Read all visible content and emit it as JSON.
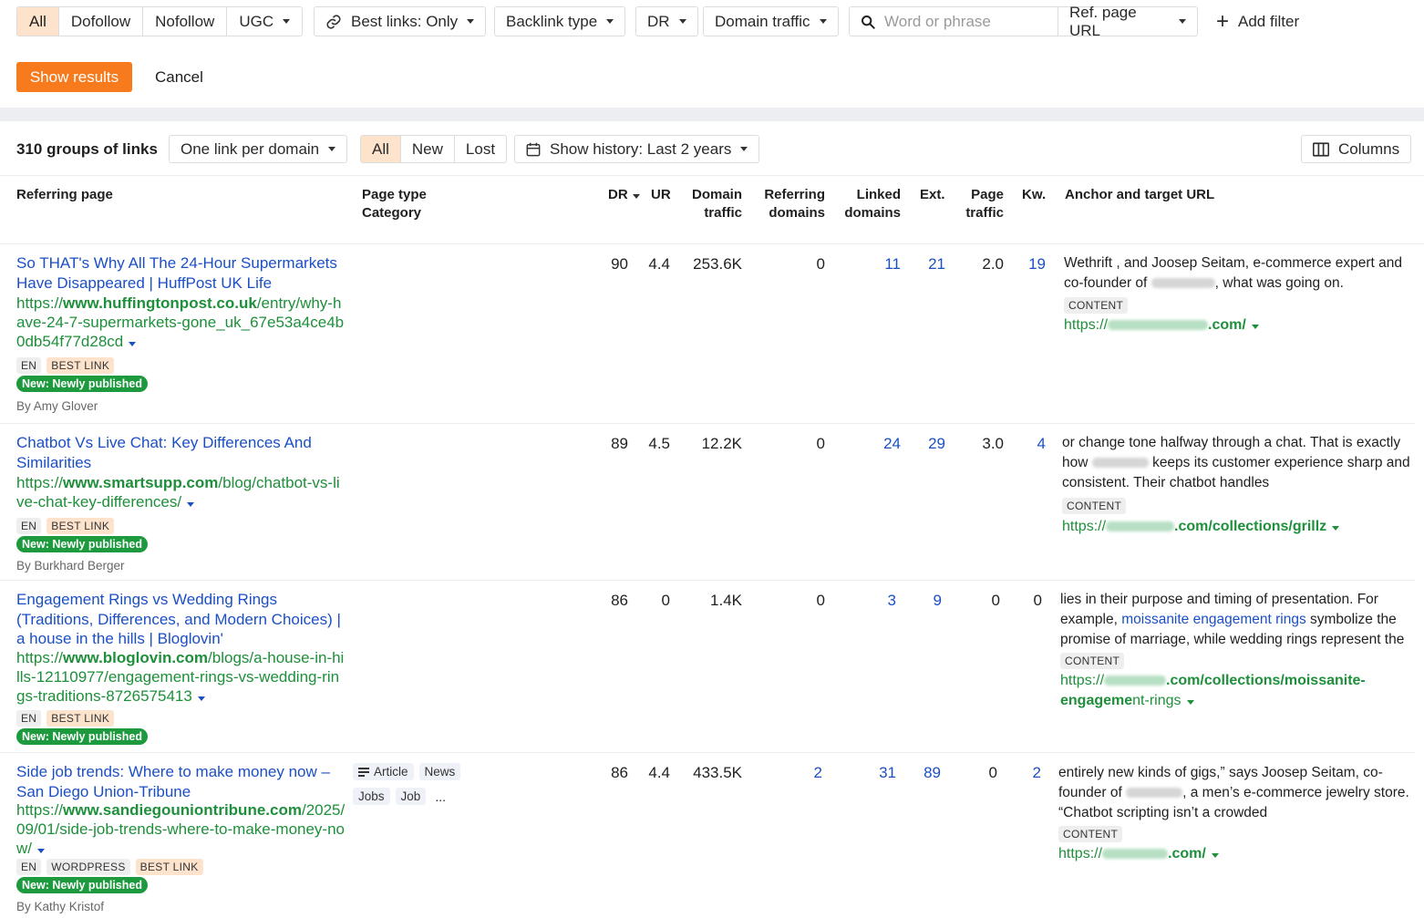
{
  "filters": {
    "link_types": [
      "All",
      "Dofollow",
      "Nofollow",
      "UGC"
    ],
    "best_links": "Best links: Only",
    "backlink_type": "Backlink type",
    "dr": "DR",
    "domain_traffic": "Domain traffic",
    "search_placeholder": "Word or phrase",
    "ref_page_url": "Ref. page URL",
    "add_filter": "Add filter",
    "show_results": "Show results",
    "cancel": "Cancel"
  },
  "toolbar": {
    "groups_count": "310 groups of links",
    "grouping": "One link per domain",
    "status_tabs": [
      "All",
      "New",
      "Lost"
    ],
    "history": "Show history: Last 2 years",
    "columns": "Columns"
  },
  "columns": {
    "referring_page": "Referring page",
    "page_type": "Page type",
    "category": "Category",
    "dr": "DR",
    "ur": "UR",
    "domain_traffic": [
      "Domain",
      "traffic"
    ],
    "referring_domains": [
      "Referring",
      "domains"
    ],
    "linked_domains": [
      "Linked",
      "domains"
    ],
    "ext": "Ext.",
    "page_traffic": [
      "Page",
      "traffic"
    ],
    "kw": "Kw.",
    "anchor": "Anchor and target URL"
  },
  "rows": [
    {
      "title": "So THAT's Why All The 24-Hour Supermarkets Have Disappeared | HuffPost UK Life",
      "url_prefix": "https://",
      "url_domain": "www.huffingtonpost.co.uk",
      "url_path": "/entry/why-have-24-7-supermarkets-gone_uk_67e53a4ce4b0db54f77d28cd",
      "tags": [
        "EN",
        "BEST LINK"
      ],
      "new_label": "New: Newly published",
      "author": "By Amy Glover",
      "dr": "90",
      "ur": "4.4",
      "domain_traffic": "253.6K",
      "ref_domains": "0",
      "linked_domains": "11",
      "ext": "21",
      "page_traffic": "2.0",
      "kw": "19",
      "anchor_a": "Wethrift , and Joosep Seitam, e-commerce expert and co-founder of",
      "anchor_b": ", what was going on.",
      "content": "CONTENT",
      "target_prefix": "https://",
      "target_suffix": ".com/"
    },
    {
      "title": "Chatbot Vs Live Chat: Key Differences And Similarities",
      "url_prefix": "https://",
      "url_domain": "www.smartsupp.com",
      "url_path": "/blog/chatbot-vs-live-chat-key-differences/",
      "tags": [
        "EN",
        "BEST LINK"
      ],
      "new_label": "New: Newly published",
      "author": "By Burkhard Berger",
      "dr": "89",
      "ur": "4.5",
      "domain_traffic": "12.2K",
      "ref_domains": "0",
      "linked_domains": "24",
      "ext": "29",
      "page_traffic": "3.0",
      "kw": "4",
      "anchor_a": "or change tone halfway through a chat. That is exactly how",
      "anchor_b": "keeps its customer experience sharp and consistent. Their chatbot handles",
      "content": "CONTENT",
      "target_prefix": "https://",
      "target_suffix": ".com/collections/grillz"
    },
    {
      "title": "Engagement Rings vs Wedding Rings (Traditions, Differences, and Modern Choices) | a house in the hills | Bloglovin'",
      "url_prefix": "https://",
      "url_domain": "www.bloglovin.com",
      "url_path": "/blogs/a-house-in-hills-12110977/engagement-rings-vs-wedding-rings-traditions-8726575413",
      "tags": [
        "EN",
        "BEST LINK"
      ],
      "new_label": "New: Newly published",
      "dr": "86",
      "ur": "0",
      "domain_traffic": "1.4K",
      "ref_domains": "0",
      "linked_domains": "3",
      "ext": "9",
      "page_traffic": "0",
      "kw": "0",
      "anchor_a": "lies in their purpose and timing of presentation. For example,",
      "anchor_kw": "moissanite engagement rings",
      "anchor_b": "symbolize the promise of marriage, while wedding rings represent the",
      "content": "CONTENT",
      "target_prefix": "https://",
      "target_suffix_a": ".com/collections/moissanite-engageme",
      "target_suffix_b": "nt-rings"
    },
    {
      "title": "Side job trends: Where to make money now – San Diego Union-Tribune",
      "url_prefix": "https://",
      "url_domain": "www.sandiegouniontribune.com",
      "url_path": "/2025/09/01/side-job-trends-where-to-make-money-now/",
      "page_types": [
        "Article",
        "News"
      ],
      "categories": [
        "Jobs",
        "Job",
        "..."
      ],
      "tags": [
        "EN",
        "WORDPRESS",
        "BEST LINK"
      ],
      "new_label": "New: Newly published",
      "author": "By Kathy Kristof",
      "dr": "86",
      "ur": "4.4",
      "domain_traffic": "433.5K",
      "ref_domains": "2",
      "linked_domains": "31",
      "ext": "89",
      "page_traffic": "0",
      "kw": "2",
      "anchor_a": "entirely new kinds of gigs,” says Joosep Seitam, co-founder of",
      "anchor_b": ", a men’s e-commerce jewelry store. “Chatbot scripting isn’t a crowded",
      "content": "CONTENT",
      "target_prefix": "https://",
      "target_suffix": ".com/"
    }
  ]
}
